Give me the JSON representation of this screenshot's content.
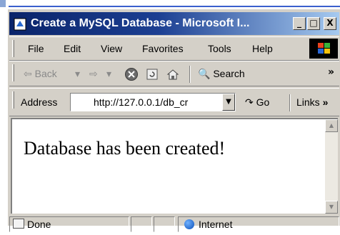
{
  "window": {
    "title": "Create a MySQL Database - Microsoft I...",
    "controls": {
      "minimize": "_",
      "maximize": "□",
      "close": "X"
    }
  },
  "menu": {
    "items": [
      {
        "label": "File"
      },
      {
        "label": "Edit"
      },
      {
        "label": "View"
      },
      {
        "label": "Favorites"
      },
      {
        "label": "Tools"
      },
      {
        "label": "Help"
      }
    ]
  },
  "toolbar": {
    "back_label": "Back",
    "search_label": "Search",
    "more": "»"
  },
  "address": {
    "label": "Address",
    "url": "http://127.0.0.1/db_cr",
    "go_label": "Go",
    "links_label": "Links",
    "links_more": "»"
  },
  "page": {
    "message": "Database has been created!"
  },
  "status": {
    "text": "Done",
    "zone": "Internet"
  },
  "colors": {
    "titlebar_start": "#0a246a",
    "titlebar_end": "#a6caf0",
    "chrome": "#d4d0c8"
  }
}
